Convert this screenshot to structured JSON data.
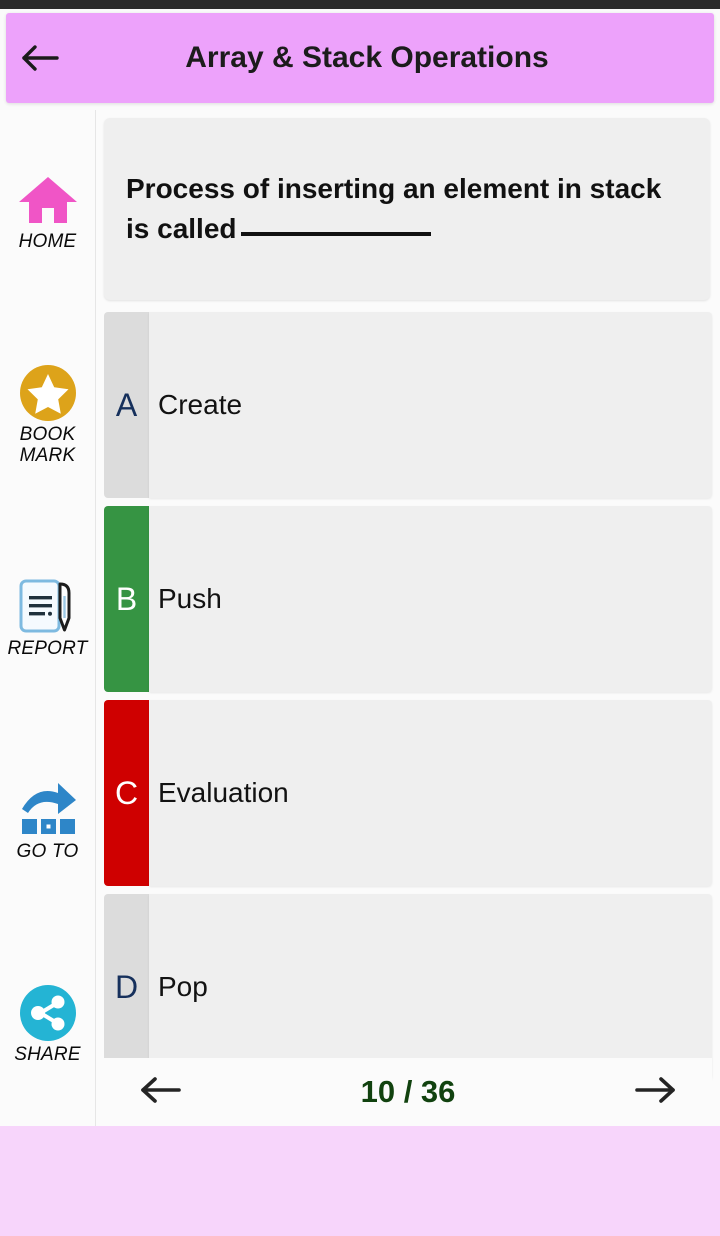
{
  "header": {
    "title": "Array & Stack Operations",
    "back_icon": "arrow-left-icon"
  },
  "sidebar": {
    "items": [
      {
        "label": "HOME",
        "icon": "home-icon"
      },
      {
        "label": "BOOK\nMARK",
        "label_line1": "BOOK",
        "label_line2": "MARK",
        "icon": "star-bookmark-icon"
      },
      {
        "label": "REPORT",
        "icon": "document-pen-icon"
      },
      {
        "label": "GO TO",
        "icon": "goto-arrow-icon"
      },
      {
        "label": "SHARE",
        "icon": "share-icon"
      }
    ]
  },
  "question": {
    "text_before_blank": "Process of inserting an element in stack is called",
    "has_blank": true
  },
  "options": [
    {
      "letter": "A",
      "text": "Create",
      "state": "neutral"
    },
    {
      "letter": "B",
      "text": "Push",
      "state": "correct"
    },
    {
      "letter": "C",
      "text": "Evaluation",
      "state": "wrong"
    },
    {
      "letter": "D",
      "text": "Pop",
      "state": "neutral"
    }
  ],
  "footer": {
    "prev_icon": "arrow-left-icon",
    "next_icon": "arrow-right-icon",
    "page_indicator": "10 / 36",
    "current_page": 10,
    "total_pages": 36
  },
  "colors": {
    "header_pink": "#EDA2FB",
    "banner_pink": "#F7D5FB",
    "correct_green": "#369443",
    "wrong_red": "#CF0000",
    "neutral_gray": "#DCDCDC",
    "card_gray": "#EFEFEF",
    "letter_navy": "#16305C",
    "page_green": "#11420F",
    "home_pink": "#F055C6",
    "bookmark_gold": "#DDA31A",
    "share_cyan": "#24B4D4",
    "goto_blue": "#2E86C8"
  }
}
